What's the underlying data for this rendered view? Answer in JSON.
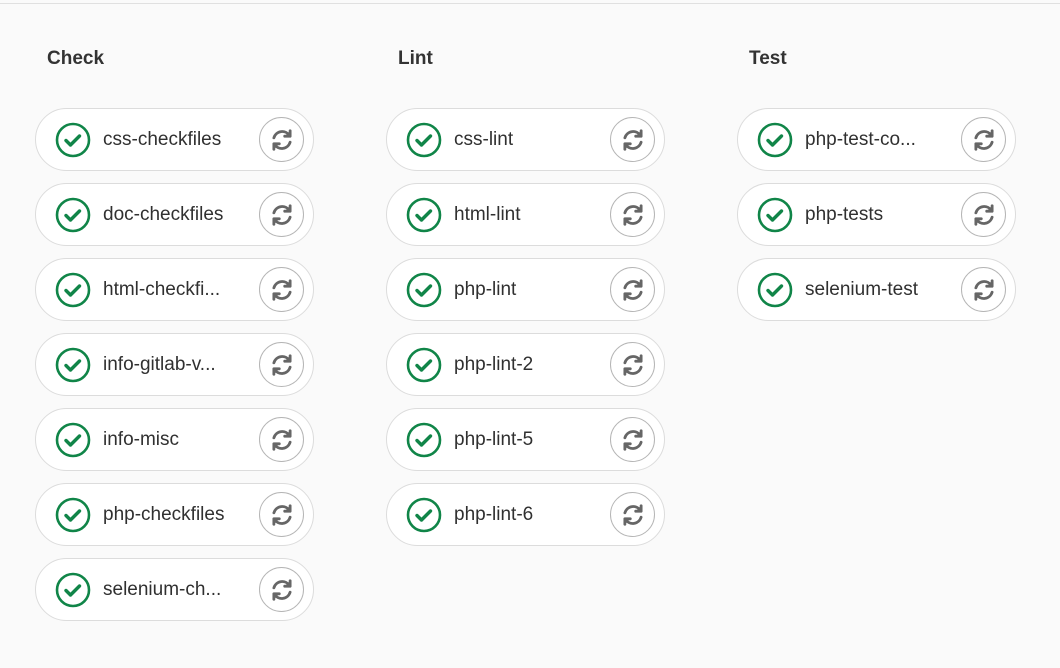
{
  "colors": {
    "success": "#108548",
    "retry": "#666666"
  },
  "stages": [
    {
      "title": "Check",
      "jobs": [
        {
          "name": "css-checkfiles",
          "status": "success"
        },
        {
          "name": "doc-checkfiles",
          "status": "success"
        },
        {
          "name": "html-checkfi...",
          "status": "success"
        },
        {
          "name": "info-gitlab-v...",
          "status": "success"
        },
        {
          "name": "info-misc",
          "status": "success"
        },
        {
          "name": "php-checkfiles",
          "status": "success"
        },
        {
          "name": "selenium-ch...",
          "status": "success"
        }
      ]
    },
    {
      "title": "Lint",
      "jobs": [
        {
          "name": "css-lint",
          "status": "success"
        },
        {
          "name": "html-lint",
          "status": "success"
        },
        {
          "name": "php-lint",
          "status": "success"
        },
        {
          "name": "php-lint-2",
          "status": "success"
        },
        {
          "name": "php-lint-5",
          "status": "success"
        },
        {
          "name": "php-lint-6",
          "status": "success"
        }
      ]
    },
    {
      "title": "Test",
      "jobs": [
        {
          "name": "php-test-co...",
          "status": "success"
        },
        {
          "name": "php-tests",
          "status": "success"
        },
        {
          "name": "selenium-test",
          "status": "success"
        }
      ]
    }
  ]
}
